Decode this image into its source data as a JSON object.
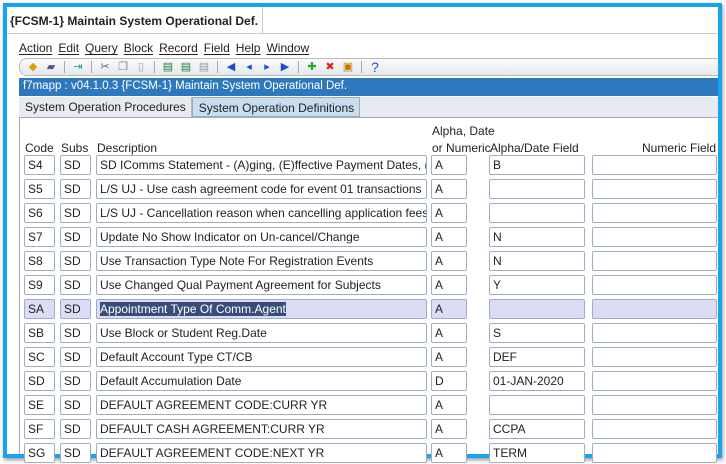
{
  "window": {
    "title": "{FCSM-1} Maintain System Operational Def."
  },
  "menu": [
    "Action",
    "Edit",
    "Query",
    "Block",
    "Record",
    "Field",
    "Help",
    "Window"
  ],
  "toolbar": {
    "help": "?"
  },
  "form_bar": "f7mapp : v04.1.0.3  {FCSM-1} Maintain System Operational Def.",
  "tabs": [
    {
      "label": "System Operation Procedures",
      "active": false
    },
    {
      "label": "System Operation Definitions",
      "active": true
    }
  ],
  "columns": {
    "code": "Code",
    "subs": "Subs",
    "description": "Description",
    "type_line1": "Alpha, Date",
    "type_line2": "or Numeric",
    "alpha": "Alpha/Date Field",
    "numeric": "Numeric Field"
  },
  "rows": [
    {
      "code": "S4",
      "subs": "SD",
      "description": "SD IComms Statement - (A)ging, (E)ffective Payment Dates, (I",
      "type": "A",
      "alpha": "B",
      "numeric": ""
    },
    {
      "code": "S5",
      "subs": "SD",
      "description": "L/S UJ - Use cash agreement code for event 01 transactions",
      "type": "A",
      "alpha": "",
      "numeric": ""
    },
    {
      "code": "S6",
      "subs": "SD",
      "description": "L/S UJ - Cancellation reason when cancelling application fees",
      "type": "A",
      "alpha": "",
      "numeric": ""
    },
    {
      "code": "S7",
      "subs": "SD",
      "description": "Update No Show Indicator on Un-cancel/Change",
      "type": "A",
      "alpha": "N",
      "numeric": ""
    },
    {
      "code": "S8",
      "subs": "SD",
      "description": "Use Transaction Type Note For Registration Events",
      "type": "A",
      "alpha": "N",
      "numeric": ""
    },
    {
      "code": "S9",
      "subs": "SD",
      "description": "Use Changed Qual Payment Agreement for Subjects",
      "type": "A",
      "alpha": "Y",
      "numeric": ""
    },
    {
      "code": "SA",
      "subs": "SD",
      "description": "Appointment Type Of Comm.Agent",
      "type": "A",
      "alpha": "",
      "numeric": "",
      "selected": true
    },
    {
      "code": "SB",
      "subs": "SD",
      "description": "Use Block or Student Reg.Date",
      "type": "A",
      "alpha": "S",
      "numeric": ""
    },
    {
      "code": "SC",
      "subs": "SD",
      "description": "Default Account Type CT/CB",
      "type": "A",
      "alpha": "DEF",
      "numeric": ""
    },
    {
      "code": "SD",
      "subs": "SD",
      "description": "Default Accumulation Date",
      "type": "D",
      "alpha": "01-JAN-2020",
      "numeric": ""
    },
    {
      "code": "SE",
      "subs": "SD",
      "description": "DEFAULT AGREEMENT CODE:CURR YR",
      "type": "A",
      "alpha": "",
      "numeric": ""
    },
    {
      "code": "SF",
      "subs": "SD",
      "description": "DEFAULT CASH AGREEMENT:CURR YR",
      "type": "A",
      "alpha": "CCPA",
      "numeric": ""
    },
    {
      "code": "SG",
      "subs": "SD",
      "description": "DEFAULT AGREEMENT CODE:NEXT YR",
      "type": "A",
      "alpha": "TERM",
      "numeric": ""
    }
  ]
}
